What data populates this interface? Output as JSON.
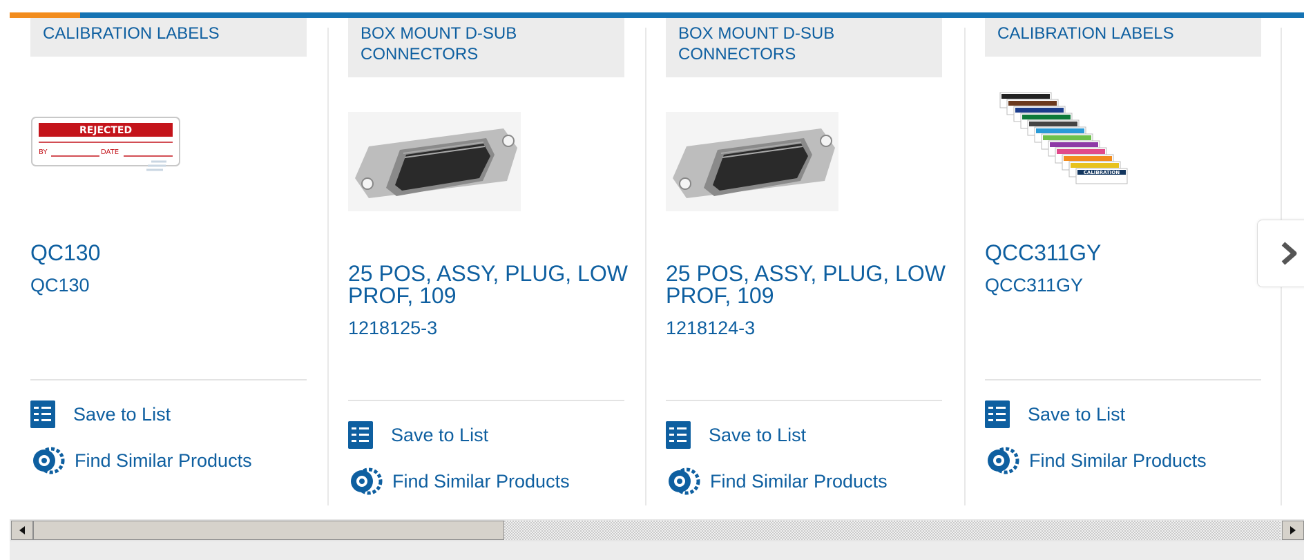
{
  "products": [
    {
      "category": "CALIBRATION LABELS",
      "title": "QC130",
      "part_number": "QC130",
      "save_label": "Save to List",
      "similar_label": "Find Similar Products",
      "image_text": {
        "header": "REJECTED",
        "by": "BY",
        "date": "DATE"
      }
    },
    {
      "category": "BOX MOUNT D-SUB CONNECTORS",
      "title": "25 POS, ASSY, PLUG, LOW PROF, 109",
      "part_number": "1218125-3",
      "save_label": "Save to List",
      "similar_label": "Find Similar Products"
    },
    {
      "category": "BOX MOUNT D-SUB CONNECTORS",
      "title": "25 POS, ASSY, PLUG, LOW PROF, 109",
      "part_number": "1218124-3",
      "save_label": "Save to List",
      "similar_label": "Find Similar Products"
    },
    {
      "category": "CALIBRATION LABELS",
      "title": "QCC311GY",
      "part_number": "QCC311GY",
      "save_label": "Save to List",
      "similar_label": "Find Similar Products",
      "image_text": {
        "label": "CALIBRATION"
      }
    }
  ],
  "icons": {
    "save": "checklist-icon",
    "similar": "gear-icon",
    "next": "chevron-right-icon",
    "scroll_left": "triangle-left-icon",
    "scroll_right": "triangle-right-icon"
  },
  "colors": {
    "brand_blue": "#0e5fa0",
    "accent_orange": "#f28c1d",
    "bar_blue": "#1573b3"
  }
}
